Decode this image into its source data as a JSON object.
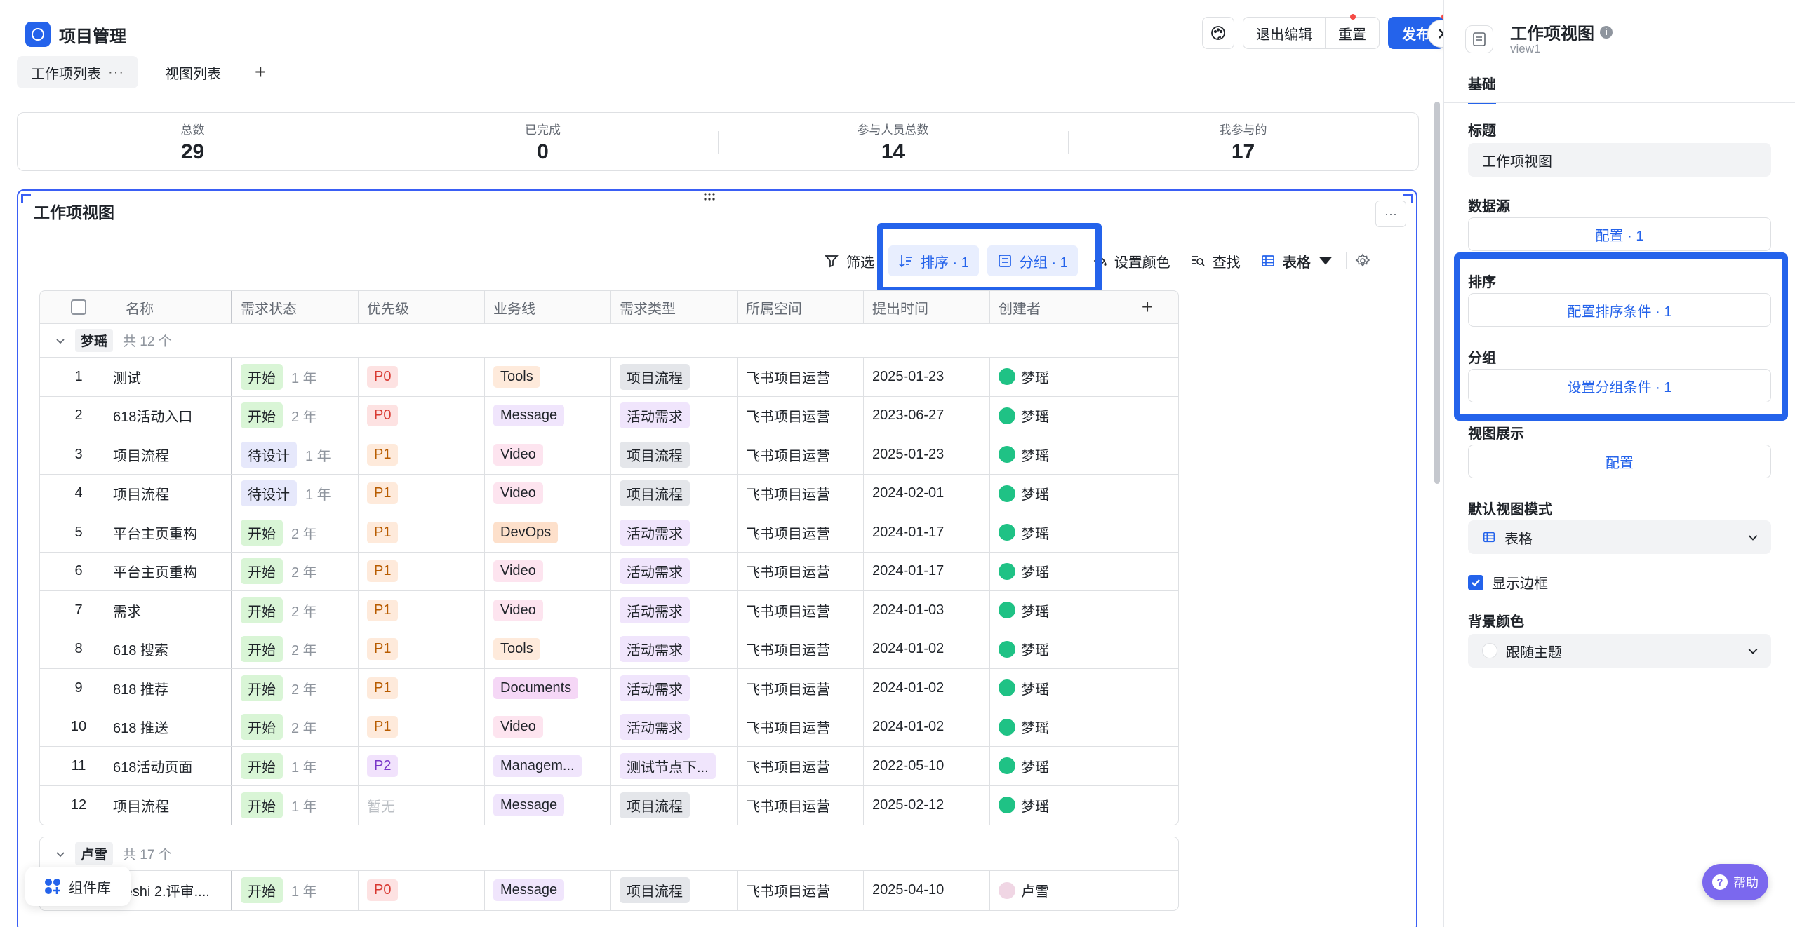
{
  "header": {
    "app_title": "项目管理",
    "tabs": [
      {
        "label": "工作项列表",
        "active": true,
        "more": "···"
      },
      {
        "label": "视图列表",
        "active": false
      }
    ],
    "add_tab": "+",
    "exit_edit": "退出编辑",
    "reset": "重置",
    "publish": "发布"
  },
  "stats": [
    {
      "label": "总数",
      "value": "29"
    },
    {
      "label": "已完成",
      "value": "0"
    },
    {
      "label": "参与人员总数",
      "value": "14"
    },
    {
      "label": "我参与的",
      "value": "17"
    }
  ],
  "view": {
    "title": "工作项视图",
    "more": "···",
    "toolbar": {
      "filter": "筛选",
      "sort": "排序 · 1",
      "group": "分组 · 1",
      "color": "设置颜色",
      "find": "查找",
      "mode": "表格"
    }
  },
  "table": {
    "columns": [
      "名称",
      "需求状态",
      "优先级",
      "业务线",
      "需求类型",
      "所属空间",
      "提出时间",
      "创建者"
    ],
    "add_col": "+",
    "groups": [
      {
        "name": "梦瑶",
        "count": "共 12 个",
        "rows": [
          {
            "idx": "1",
            "name": "测试",
            "status": "开始",
            "dur": "1 年",
            "prio": "P0",
            "biz": "Tools",
            "type": "项目流程",
            "space": "飞书项目运营",
            "date": "2025-01-23",
            "creator": "梦瑶"
          },
          {
            "idx": "2",
            "name": "618活动入口",
            "status": "开始",
            "dur": "2 年",
            "prio": "P0",
            "biz": "Message",
            "type": "活动需求",
            "space": "飞书项目运营",
            "date": "2023-06-27",
            "creator": "梦瑶"
          },
          {
            "idx": "3",
            "name": "项目流程",
            "status": "待设计",
            "dur": "1 年",
            "prio": "P1",
            "biz": "Video",
            "type": "项目流程",
            "space": "飞书项目运营",
            "date": "2025-01-23",
            "creator": "梦瑶"
          },
          {
            "idx": "4",
            "name": "项目流程",
            "status": "待设计",
            "dur": "1 年",
            "prio": "P1",
            "biz": "Video",
            "type": "项目流程",
            "space": "飞书项目运营",
            "date": "2024-02-01",
            "creator": "梦瑶"
          },
          {
            "idx": "5",
            "name": "平台主页重构",
            "status": "开始",
            "dur": "2 年",
            "prio": "P1",
            "biz": "DevOps",
            "type": "活动需求",
            "space": "飞书项目运营",
            "date": "2024-01-17",
            "creator": "梦瑶"
          },
          {
            "idx": "6",
            "name": "平台主页重构",
            "status": "开始",
            "dur": "2 年",
            "prio": "P1",
            "biz": "Video",
            "type": "活动需求",
            "space": "飞书项目运营",
            "date": "2024-01-17",
            "creator": "梦瑶"
          },
          {
            "idx": "7",
            "name": "需求",
            "status": "开始",
            "dur": "2 年",
            "prio": "P1",
            "biz": "Video",
            "type": "活动需求",
            "space": "飞书项目运营",
            "date": "2024-01-03",
            "creator": "梦瑶"
          },
          {
            "idx": "8",
            "name": "618 搜索",
            "status": "开始",
            "dur": "2 年",
            "prio": "P1",
            "biz": "Tools",
            "type": "活动需求",
            "space": "飞书项目运营",
            "date": "2024-01-02",
            "creator": "梦瑶"
          },
          {
            "idx": "9",
            "name": "818 推荐",
            "status": "开始",
            "dur": "2 年",
            "prio": "P1",
            "biz": "Documents",
            "type": "活动需求",
            "space": "飞书项目运营",
            "date": "2024-01-02",
            "creator": "梦瑶"
          },
          {
            "idx": "10",
            "name": "618 推送",
            "status": "开始",
            "dur": "2 年",
            "prio": "P1",
            "biz": "Video",
            "type": "活动需求",
            "space": "飞书项目运营",
            "date": "2024-01-02",
            "creator": "梦瑶"
          },
          {
            "idx": "11",
            "name": "618活动页面",
            "status": "开始",
            "dur": "1 年",
            "prio": "P2",
            "biz": "Managem...",
            "type": "测试节点下...",
            "space": "飞书项目运营",
            "date": "2022-05-10",
            "creator": "梦瑶"
          },
          {
            "idx": "12",
            "name": "项目流程",
            "status": "开始",
            "dur": "1 年",
            "prio": "暂无",
            "biz": "Message",
            "type": "项目流程",
            "space": "飞书项目运营",
            "date": "2025-02-12",
            "creator": "梦瑶"
          }
        ]
      },
      {
        "name": "卢雪",
        "count": "共 17 个",
        "rows": [
          {
            "idx": "",
            "name": "...eshi 2.评审....",
            "status": "开始",
            "dur": "1 年",
            "prio": "P0",
            "biz": "Message",
            "type": "项目流程",
            "space": "飞书项目运营",
            "date": "2025-04-10",
            "creator": "卢雪"
          }
        ]
      }
    ]
  },
  "component_lib": "组件库",
  "panel": {
    "title": "工作项视图",
    "subtitle": "view1",
    "tab": "基础",
    "title_label": "标题",
    "title_value": "工作项视图",
    "datasource_label": "数据源",
    "datasource_btn": "配置 · 1",
    "sort_label": "排序",
    "sort_btn": "配置排序条件 · 1",
    "group_label": "分组",
    "group_btn": "设置分组条件 · 1",
    "display_label": "视图展示",
    "display_btn": "配置",
    "mode_label": "默认视图模式",
    "mode_value": "表格",
    "border_label": "显示边框",
    "bg_label": "背景颜色",
    "bg_value": "跟随主题"
  },
  "help": "帮助",
  "colors": {
    "accent": "#2463eb",
    "highlight": "#2463eb"
  }
}
